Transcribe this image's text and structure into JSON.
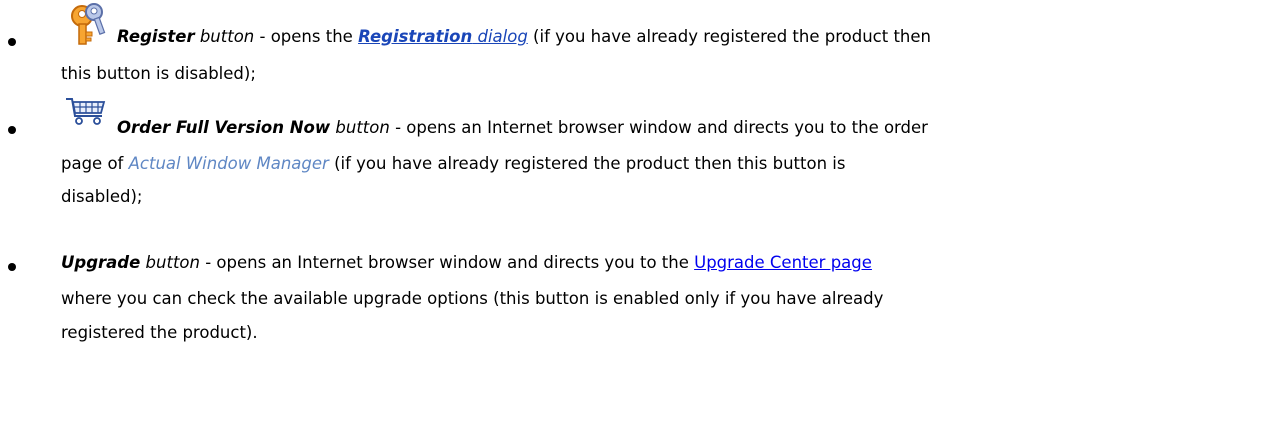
{
  "items": [
    {
      "icon": "keys-icon",
      "button_name": "Register",
      "button_word": "button",
      "dash": " - opens the ",
      "link_bold": "Registration",
      "link_italic": "dialog",
      "line1_rest": " (if you have already registered the product then",
      "line2": "this button is disabled);"
    },
    {
      "icon": "shopping-cart-icon",
      "button_name": "Order Full Version Now",
      "button_word": "button",
      "line1_rest": " - opens an Internet browser window and directs you to the order",
      "line2_pre": "page of ",
      "product": "Actual Window Manager",
      "line2_rest": " (if you have already registered the product then this button is",
      "line3": "disabled);"
    },
    {
      "button_name": "Upgrade",
      "button_word": "button",
      "line1_mid": " - opens an Internet browser window and directs you to the ",
      "link": "Upgrade Center page",
      "line2": "where you can check the available upgrade options (this button is enabled only if you have already",
      "line3": "registered the product)."
    }
  ],
  "colors": {
    "text": "#000000",
    "link": "#0000ee",
    "product_name": "#5f87c4"
  }
}
